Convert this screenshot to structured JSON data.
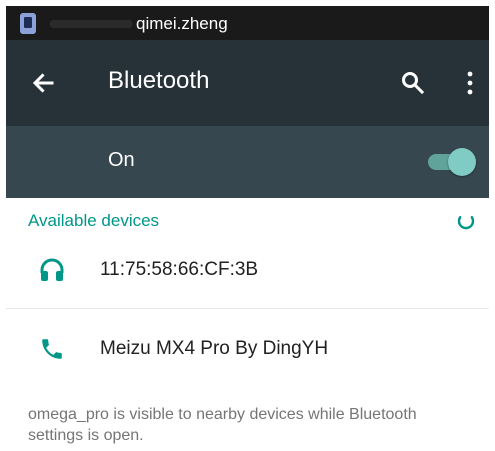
{
  "status_bar": {
    "user": "qimei.zheng",
    "app_icon": "phone-icon"
  },
  "toolbar": {
    "back_icon": "arrow-left-icon",
    "title": "Bluetooth",
    "search_icon": "search-icon",
    "menu_icon": "more-vertical-icon"
  },
  "switch": {
    "label": "On",
    "enabled": true
  },
  "available_devices": {
    "header": "Available devices",
    "loading_icon": "refresh-spinner-icon",
    "items": [
      {
        "name": "11:75:58:66:CF:3B",
        "icon": "headphones-icon"
      },
      {
        "name": "Meizu MX4 Pro By DingYH",
        "icon": "phone-icon"
      }
    ]
  },
  "footer": {
    "text": "omega_pro is visible to nearby devices while Bluetooth settings is open."
  },
  "colors": {
    "toolbar_bg": "#263238",
    "switchbar_bg": "#37474f",
    "accent": "#009688",
    "toggle_on": "#80cbc4"
  }
}
